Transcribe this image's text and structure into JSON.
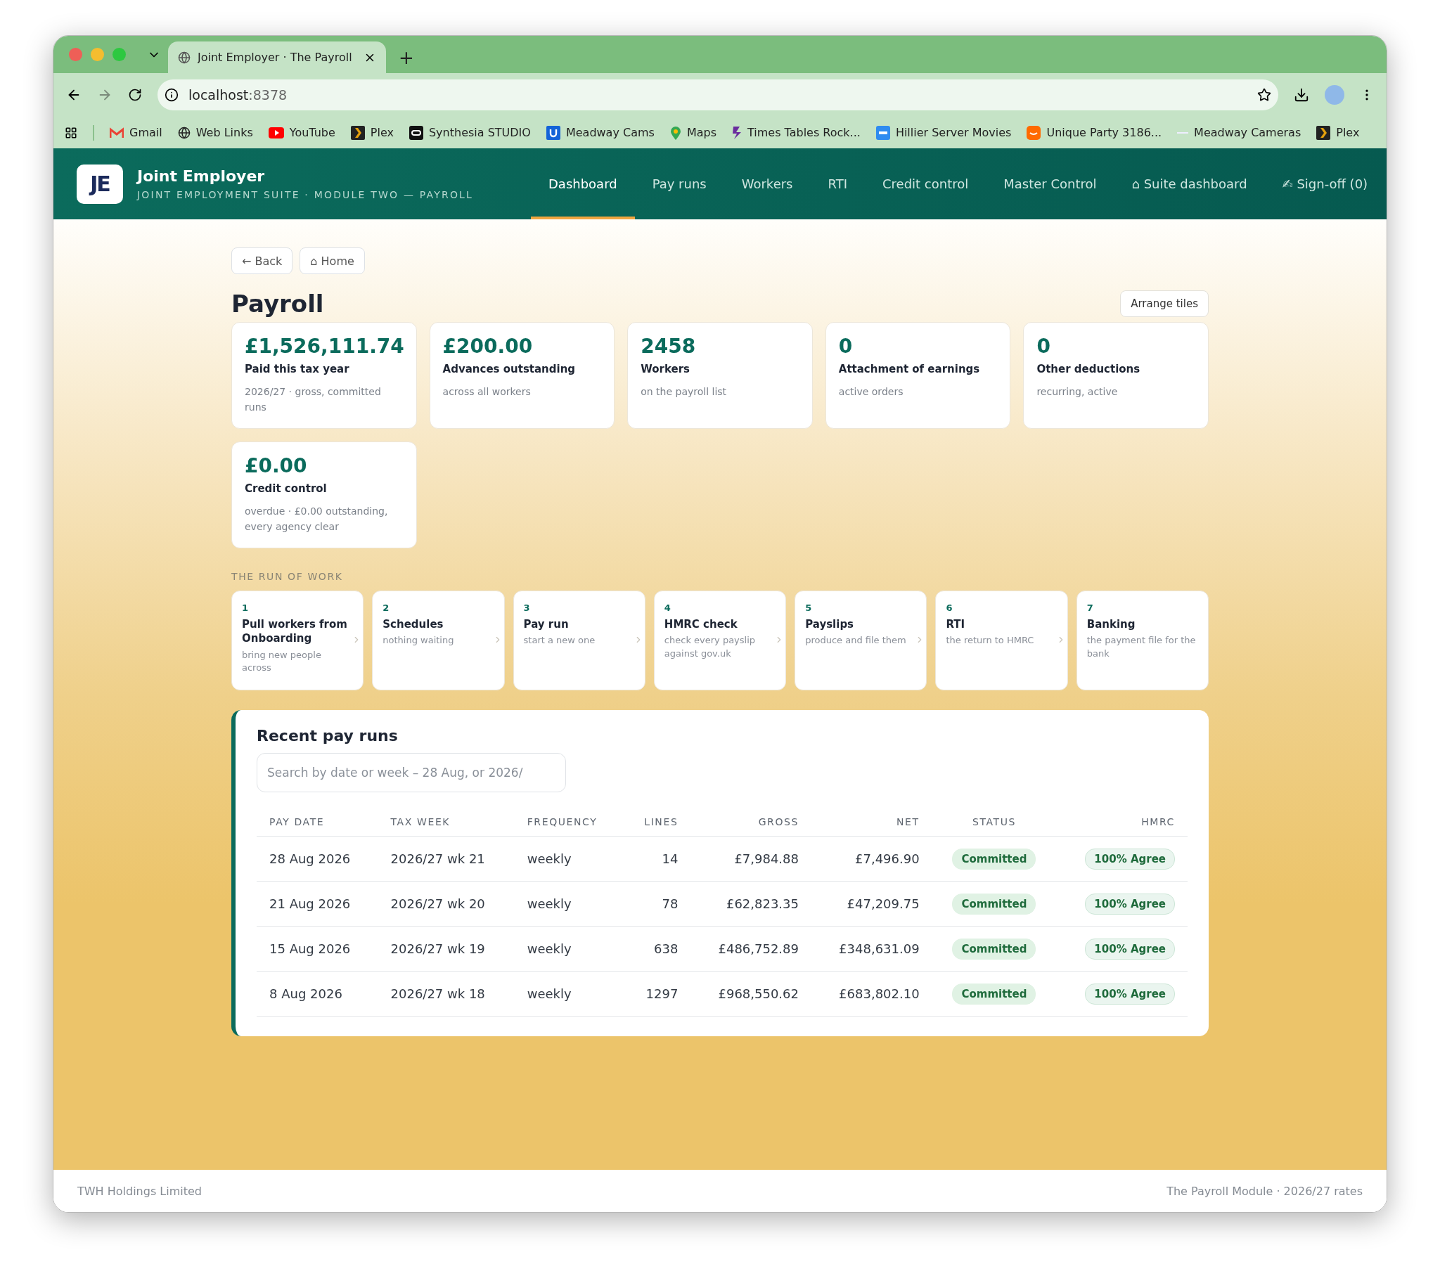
{
  "browser": {
    "tab_title": "Joint Employer · The Payroll",
    "new_tab": "+",
    "address": {
      "host": "localhost",
      "port": ":8378"
    },
    "bookmarks": [
      {
        "label": "Gmail",
        "kind": "gmail"
      },
      {
        "label": "Web Links",
        "kind": "globe"
      },
      {
        "label": "YouTube",
        "kind": "youtube"
      },
      {
        "label": "Plex",
        "kind": "plex"
      },
      {
        "label": "Synthesia STUDIO",
        "kind": "synthesia"
      },
      {
        "label": "Meadway Cams",
        "kind": "u"
      },
      {
        "label": "Maps",
        "kind": "pin"
      },
      {
        "label": "Times Tables Rock...",
        "kind": "bolt"
      },
      {
        "label": "Hillier Server Movies",
        "kind": "dsm"
      },
      {
        "label": "Unique Party 3186...",
        "kind": "amazon"
      },
      {
        "label": "Meadway Cameras",
        "kind": "dash"
      },
      {
        "label": "Plex",
        "kind": "plex"
      }
    ]
  },
  "app": {
    "logo": "JE",
    "title": "Joint Employer",
    "subtitle": "JOINT EMPLOYMENT SUITE · MODULE TWO — PAYROLL",
    "nav": [
      {
        "label": "Dashboard",
        "selected": true
      },
      {
        "label": "Pay runs",
        "selected": false
      },
      {
        "label": "Workers",
        "selected": false
      },
      {
        "label": "RTI",
        "selected": false
      },
      {
        "label": "Credit control",
        "selected": false
      },
      {
        "label": "Master Control",
        "selected": false
      },
      {
        "label": "⌂ Suite dashboard",
        "selected": false
      },
      {
        "label": "✍ Sign-off (0)",
        "selected": false
      }
    ]
  },
  "toolbar": {
    "back": "← Back",
    "home": "⌂ Home"
  },
  "page_title": "Payroll",
  "arrange_button": "Arrange tiles",
  "tiles": [
    {
      "value": "£1,526,111.74",
      "label": "Paid this tax year",
      "note": "2026/27 · gross, committed runs"
    },
    {
      "value": "£200.00",
      "label": "Advances outstanding",
      "note": "across all workers"
    },
    {
      "value": "2458",
      "label": "Workers",
      "note": "on the payroll list"
    },
    {
      "value": "0",
      "label": "Attachment of earnings",
      "note": "active orders"
    },
    {
      "value": "0",
      "label": "Other deductions",
      "note": "recurring, active"
    },
    {
      "value": "£0.00",
      "label": "Credit control",
      "note": "overdue · £0.00 outstanding, every agency clear"
    }
  ],
  "run_of_work": {
    "heading": "THE RUN OF WORK",
    "steps": [
      {
        "number": "1",
        "title": "Pull workers from Onboarding",
        "note": "bring new people across"
      },
      {
        "number": "2",
        "title": "Schedules",
        "note": "nothing waiting"
      },
      {
        "number": "3",
        "title": "Pay run",
        "note": "start a new one"
      },
      {
        "number": "4",
        "title": "HMRC check",
        "note": "check every payslip against gov.uk"
      },
      {
        "number": "5",
        "title": "Payslips",
        "note": "produce and file them"
      },
      {
        "number": "6",
        "title": "RTI",
        "note": "the return to HMRC"
      },
      {
        "number": "7",
        "title": "Banking",
        "note": "the payment file for the bank"
      }
    ]
  },
  "recent_pay_runs": {
    "title": "Recent pay runs",
    "search": {
      "placeholder": "Search by date or week – 28 Aug, or 2026/"
    },
    "columns": [
      "PAY DATE",
      "TAX WEEK",
      "FREQUENCY",
      "LINES",
      "GROSS",
      "NET",
      "STATUS",
      "HMRC"
    ],
    "rows": [
      {
        "pay_date": "28 Aug 2026",
        "tax_week": "2026/27 wk 21",
        "frequency": "weekly",
        "lines": "14",
        "gross": "£7,984.88",
        "net": "£7,496.90",
        "status": "Committed",
        "hmrc": "100% Agree"
      },
      {
        "pay_date": "21 Aug 2026",
        "tax_week": "2026/27 wk 20",
        "frequency": "weekly",
        "lines": "78",
        "gross": "£62,823.35",
        "net": "£47,209.75",
        "status": "Committed",
        "hmrc": "100% Agree"
      },
      {
        "pay_date": "15 Aug 2026",
        "tax_week": "2026/27 wk 19",
        "frequency": "weekly",
        "lines": "638",
        "gross": "£486,752.89",
        "net": "£348,631.09",
        "status": "Committed",
        "hmrc": "100% Agree"
      },
      {
        "pay_date": "8 Aug 2026",
        "tax_week": "2026/27 wk 18",
        "frequency": "weekly",
        "lines": "1297",
        "gross": "£968,550.62",
        "net": "£683,802.10",
        "status": "Committed",
        "hmrc": "100% Agree"
      }
    ]
  },
  "footer": {
    "left": "TWH Holdings Limited",
    "right": "The Payroll Module · 2026/27 rates"
  }
}
